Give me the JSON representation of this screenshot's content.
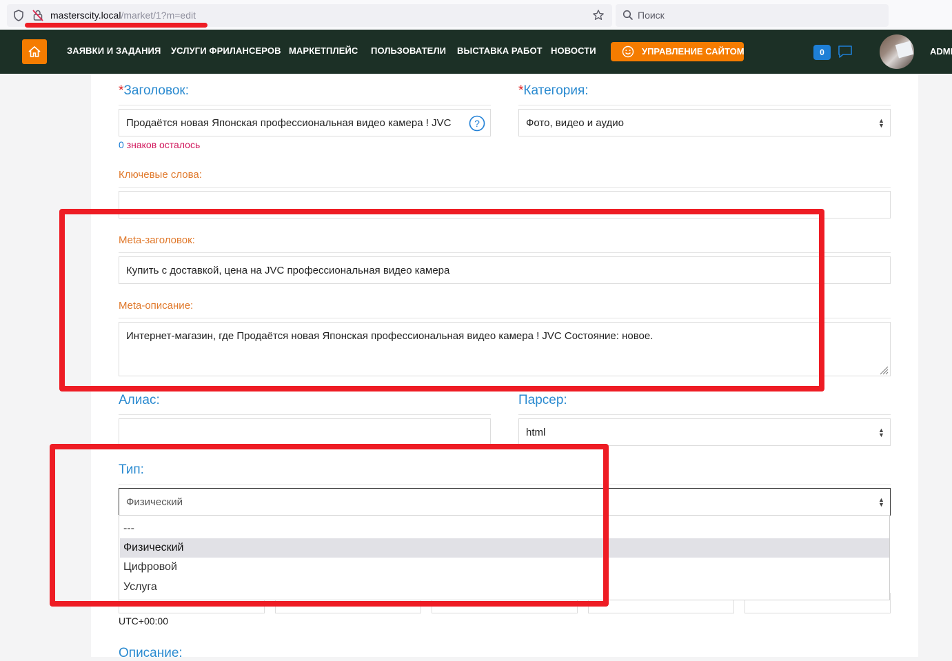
{
  "browser": {
    "url_host": "masterscity.local",
    "url_path": "/market/1?m=edit",
    "search_placeholder": "Поиск"
  },
  "nav": {
    "items": [
      {
        "label": "ЗАЯВКИ И ЗАДАНИЯ"
      },
      {
        "label": "УСЛУГИ ФРИЛАНСЕРОВ"
      },
      {
        "label": "МАРКЕТПЛЕЙС"
      },
      {
        "label": "ПОЛЬЗОВАТЕЛИ"
      },
      {
        "label": "ВЫСТАВКА РАБОТ"
      },
      {
        "label": "НОВОСТИ"
      }
    ],
    "admin_button": "УПРАВЛЕНИЕ САЙТОМ",
    "message_count": "0",
    "user_name": "ADMI",
    "colors": {
      "bar": "#1c3026",
      "accent": "#f57c00"
    }
  },
  "form": {
    "title_label": "Заголовок:",
    "title_value": "Продаётся новая Японская профессиональная видео камера ! JVC",
    "chars_left_count": "0",
    "chars_left_text": "знаков осталось",
    "category_label": "Категория:",
    "category_value": "Фото, видео и аудио",
    "keywords_label": "Ключевые слова:",
    "keywords_value": "",
    "meta_title_label": "Meta-заголовок:",
    "meta_title_value": "Купить с доставкой, цена на JVC профессиональная видео камера",
    "meta_desc_label": "Meta-описание:",
    "meta_desc_value": "Интернет-магазин, где Продаётся новая Японская профессиональная видео камера ! JVC Состояние: новое.",
    "alias_label": "Алиас:",
    "alias_value": "",
    "parser_label": "Парсер:",
    "parser_value": "html",
    "type_label": "Тип:",
    "type_value": "Физический",
    "type_options": [
      "---",
      "Физический",
      "Цифровой",
      "Услуга"
    ],
    "timezone": "UTC+00:00",
    "description_label": "Описание:"
  },
  "required_mark": "*"
}
